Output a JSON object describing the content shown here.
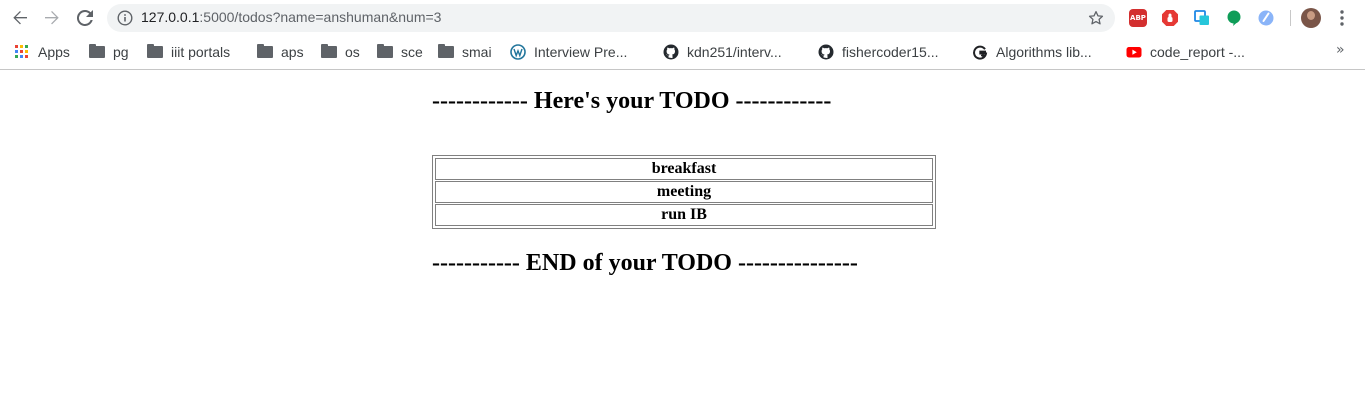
{
  "browser": {
    "url_host": "127.0.0.1",
    "url_rest": ":5000/todos?name=anshuman&num=3",
    "extensions": [
      "ABP"
    ],
    "bookmarks": [
      {
        "label": "Apps",
        "icon": "apps-grid-icon"
      },
      {
        "label": "pg",
        "icon": "folder-icon"
      },
      {
        "label": "iiit portals",
        "icon": "folder-icon"
      },
      {
        "label": "aps",
        "icon": "folder-icon"
      },
      {
        "label": "os",
        "icon": "folder-icon"
      },
      {
        "label": "sce",
        "icon": "folder-icon"
      },
      {
        "label": "smai",
        "icon": "folder-icon"
      },
      {
        "label": "Interview Pre...",
        "icon": "wordpress-icon"
      },
      {
        "label": "kdn251/interv...",
        "icon": "github-icon"
      },
      {
        "label": "fishercoder15...",
        "icon": "github-icon"
      },
      {
        "label": "Algorithms lib...",
        "icon": "g-plus-icon"
      },
      {
        "label": "code_report -...",
        "icon": "youtube-icon"
      }
    ],
    "overflow": "»"
  },
  "page": {
    "top_heading": "------------ Here's your TODO ------------",
    "todos": [
      "breakfast",
      "meeting",
      "run IB"
    ],
    "bottom_heading": "----------- END of your TODO ---------------"
  }
}
